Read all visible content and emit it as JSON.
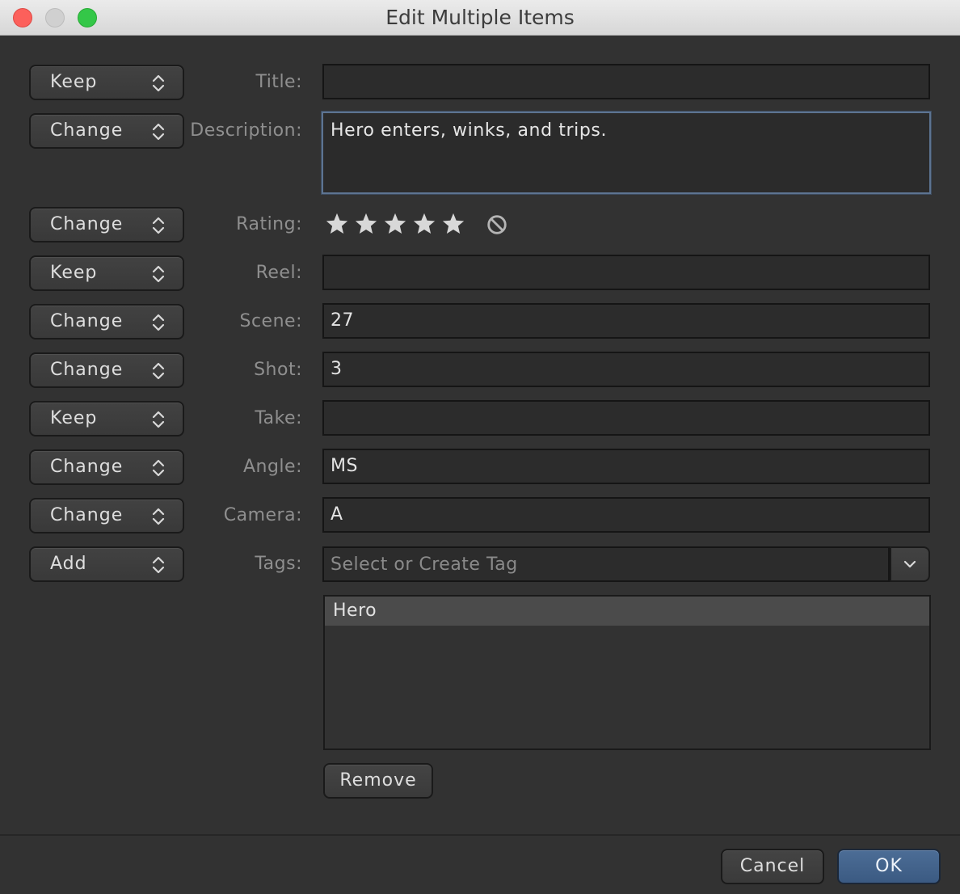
{
  "window": {
    "title": "Edit Multiple Items"
  },
  "rows": [
    {
      "mode": "Keep",
      "label": "Title:",
      "value": ""
    },
    {
      "mode": "Change",
      "label": "Description:",
      "value": "Hero enters, winks, and trips."
    },
    {
      "mode": "Change",
      "label": "Rating:",
      "stars": 5
    },
    {
      "mode": "Keep",
      "label": "Reel:",
      "value": ""
    },
    {
      "mode": "Change",
      "label": "Scene:",
      "value": "27"
    },
    {
      "mode": "Change",
      "label": "Shot:",
      "value": "3"
    },
    {
      "mode": "Keep",
      "label": "Take:",
      "value": ""
    },
    {
      "mode": "Change",
      "label": "Angle:",
      "value": "MS"
    },
    {
      "mode": "Change",
      "label": "Camera:",
      "value": "A"
    },
    {
      "mode": "Add",
      "label": "Tags:",
      "placeholder": "Select or Create Tag"
    }
  ],
  "tags": [
    "Hero"
  ],
  "buttons": {
    "remove": "Remove",
    "cancel": "Cancel",
    "ok": "OK"
  },
  "colors": {
    "accent": "#3b5a82",
    "star": "#d8d8d8",
    "background": "#323232"
  },
  "icons": {
    "updown": "updown-chevron-icon",
    "dropdown": "chevron-down-icon",
    "star": "star-icon",
    "clear": "no-rating-icon"
  }
}
